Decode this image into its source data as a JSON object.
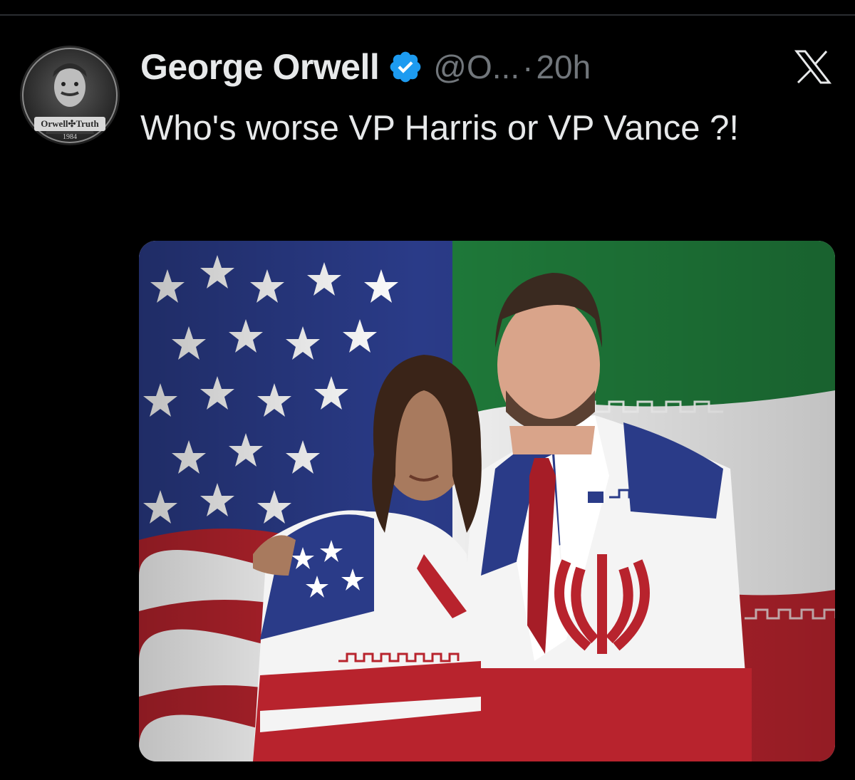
{
  "tweet": {
    "display_name": "George Orwell",
    "handle": "@O...",
    "separator": "·",
    "time": "20h",
    "text": "Who's worse VP Harris or VP Vance ?!",
    "verified": true
  },
  "avatar": {
    "badge_text": "Orwell✣Truth",
    "badge_year": "1984"
  },
  "icons": {
    "verified": "verified-badge-icon",
    "platform": "x-logo-icon"
  },
  "colors": {
    "background": "#000000",
    "text_primary": "#e7e9ea",
    "text_secondary": "#71767b",
    "verified_blue": "#1d9bf0",
    "us_blue": "#2c3e8c",
    "us_red": "#b8232d",
    "iran_green": "#1f7a3a"
  }
}
